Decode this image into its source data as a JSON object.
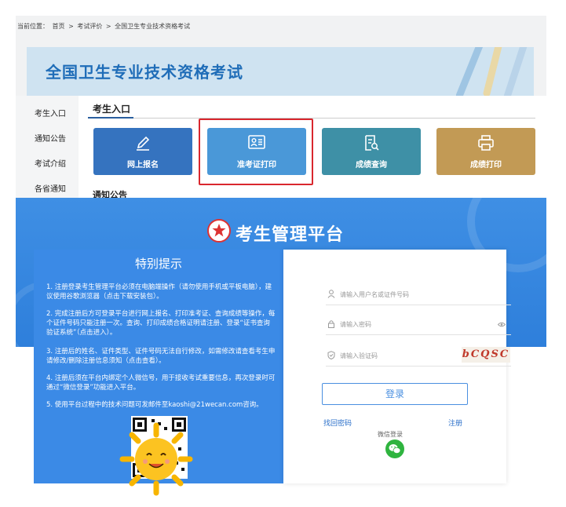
{
  "breadcrumb": {
    "prefix": "当前位置：",
    "items": [
      "首页",
      ">",
      "考试评价",
      ">",
      "全国卫生专业技术资格考试"
    ]
  },
  "banner": {
    "title": "全国卫生专业技术资格考试"
  },
  "sidebar": {
    "items": [
      {
        "label": "考生入口"
      },
      {
        "label": "通知公告"
      },
      {
        "label": "考试介绍"
      },
      {
        "label": "各省通知"
      }
    ]
  },
  "section": {
    "tab": "考生入口",
    "next_heading": "通知公告"
  },
  "tiles": [
    {
      "label": "网上报名",
      "icon": "pencil-icon",
      "color": "#3573bf"
    },
    {
      "label": "准考证打印",
      "icon": "id-card-icon",
      "color": "#4a98d8"
    },
    {
      "label": "成绩查询",
      "icon": "document-search-icon",
      "color": "#3e90a6"
    },
    {
      "label": "成绩打印",
      "icon": "printer-icon",
      "color": "#c29a55"
    }
  ],
  "platform": {
    "title": "考生管理平台"
  },
  "notice": {
    "title": "特别提示",
    "items": [
      "1. 注册登录考生管理平台必须在电脑端操作（请勿使用手机或平板电脑），建议使用谷歌浏览器（点击下载安装包）。",
      "2. 完成注册后方可登录平台进行网上报名、打印准考证、查询成绩等操作，每个证件号码只能注册一次。查询、打印成绩合格证明请注册、登录“证书查询验证系统”（点击进入）。",
      "3. 注册后的姓名、证件类型、证件号码无法自行修改，如需修改请查看考生申请修改/删除注册信息须知（点击查看）。",
      "4. 注册后须在平台内绑定个人微信号，用于接收考试重要信息，再次登录时可通过“微信登录”功能进入平台。",
      "5. 使用平台过程中的技术问题可发邮件至kaoshi@21wecan.com咨询。"
    ]
  },
  "login": {
    "username_placeholder": "请输入用户名或证件号码",
    "password_placeholder": "请输入密码",
    "captcha_placeholder": "请输入验证码",
    "captcha_text": "bCQSC",
    "submit_label": "登录",
    "forgot_label": "找回密码",
    "register_label": "注册",
    "wechat_label": "微信登录"
  },
  "colors": {
    "accent": "#2e7fdb",
    "highlight": "#d9272e",
    "wechat": "#2fb43f"
  }
}
